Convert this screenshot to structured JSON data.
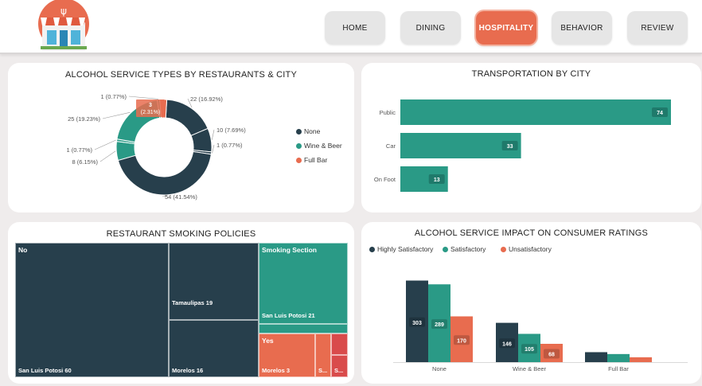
{
  "nav": {
    "items": [
      "HOME",
      "DINING",
      "HOSPITALITY",
      "BEHAVIOR",
      "REVIEW"
    ],
    "active": "HOSPITALITY"
  },
  "colors": {
    "dark": "#273f4c",
    "teal": "#2a9a86",
    "orange": "#e86c4f",
    "red": "#d94b4b"
  },
  "alcohol_card": {
    "title": "ALCOHOL SERVICE TYPES BY RESTAURANTS & CITY",
    "legend": [
      "None",
      "Wine & Beer",
      "Full Bar"
    ]
  },
  "transport_card": {
    "title": "TRANSPORTATION BY CITY"
  },
  "smoking_card": {
    "title": "RESTAURANT SMOKING POLICIES"
  },
  "impact_card": {
    "title": "ALCOHOL SERVICE IMPACT ON CONSUMER RATINGS"
  },
  "chart_data": [
    {
      "type": "pie",
      "title": "ALCOHOL SERVICE TYPES BY RESTAURANTS & CITY",
      "legend": [
        "None",
        "Wine & Beer",
        "Full Bar"
      ],
      "slices": [
        {
          "category": "None",
          "value": 22,
          "label": "22 (16.92%)"
        },
        {
          "category": "None",
          "value": 10,
          "label": "10 (7.69%)"
        },
        {
          "category": "None",
          "value": 1,
          "label": "1 (0.77%)"
        },
        {
          "category": "None",
          "value": 54,
          "label": "54 (41.54%)"
        },
        {
          "category": "Wine & Beer",
          "value": 8,
          "label": "8 (6.15%)"
        },
        {
          "category": "Wine & Beer",
          "value": 1,
          "label": "1 (0.77%)"
        },
        {
          "category": "Wine & Beer",
          "value": 25,
          "label": "25 (19.23%)"
        },
        {
          "category": "Wine & Beer",
          "value": 1,
          "label": "1 (0.77%)"
        },
        {
          "category": "Full Bar",
          "value": 3,
          "label": "3 (2.31%)"
        }
      ]
    },
    {
      "type": "bar",
      "title": "TRANSPORTATION BY CITY",
      "orientation": "horizontal",
      "categories": [
        "Public",
        "Car",
        "On Foot"
      ],
      "values": [
        74,
        33,
        13
      ]
    },
    {
      "type": "heatmap",
      "title": "RESTAURANT SMOKING POLICIES",
      "groups": [
        {
          "name": "No",
          "value": 95,
          "children": [
            {
              "name": "San Luis Potosi",
              "label": "San Luis Potosi 60",
              "value": 60
            },
            {
              "name": "Tamaulipas",
              "label": "Tamaulipas 19",
              "value": 19
            },
            {
              "name": "Morelos",
              "label": "Morelos 16",
              "value": 16
            }
          ]
        },
        {
          "name": "Smoking Section",
          "value": 23,
          "children": [
            {
              "name": "San Luis Potosi",
              "label": "San Luis Potosi 21",
              "value": 21
            },
            {
              "name": "",
              "label": "",
              "value": 2
            }
          ]
        },
        {
          "name": "Yes",
          "value": 5,
          "children": [
            {
              "name": "Morelos",
              "label": "Morelos 3",
              "value": 3
            },
            {
              "name": "",
              "label": "S...",
              "value": 1
            }
          ]
        },
        {
          "name": "",
          "value": 2,
          "children": [
            {
              "name": "",
              "label": "",
              "value": 1
            },
            {
              "name": "",
              "label": "S...",
              "value": 1
            }
          ]
        }
      ]
    },
    {
      "type": "bar",
      "title": "ALCOHOL SERVICE IMPACT ON CONSUMER RATINGS",
      "categories": [
        "None",
        "Wine & Beer",
        "Full Bar"
      ],
      "series": [
        {
          "name": "Highly Satisfactory",
          "values": [
            303,
            146,
            37
          ]
        },
        {
          "name": "Satisfactory",
          "values": [
            289,
            105,
            30
          ]
        },
        {
          "name": "Unsatisfactory",
          "values": [
            170,
            68,
            18
          ]
        }
      ],
      "ylim": [
        0,
        340
      ],
      "legend_position": "top-left"
    }
  ]
}
